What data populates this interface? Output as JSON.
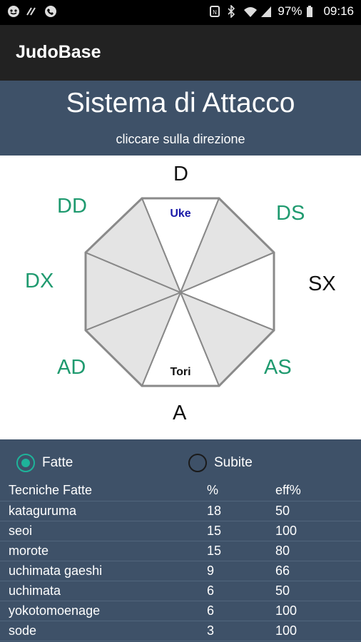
{
  "statusbar": {
    "battery": "97%",
    "time": "09:16"
  },
  "appbar": {
    "title": "JudoBase"
  },
  "header": {
    "title": "Sistema di Attacco",
    "subtitle": "cliccare sulla direzione"
  },
  "diagram": {
    "directions": {
      "d": "D",
      "ds": "DS",
      "sx": "SX",
      "as": "AS",
      "a": "A",
      "ad": "AD",
      "dx": "DX",
      "dd": "DD"
    },
    "top_label": "Uke",
    "bottom_label": "Tori",
    "colors": {
      "green": "#1f9a6f",
      "uke": "#1a1aa8",
      "segment_fill": "#e4e4e4",
      "outline": "#888888"
    }
  },
  "options": {
    "fatte": "Fatte",
    "subite": "Subite",
    "selected": "Fatte",
    "accent": "#1eb39a"
  },
  "table": {
    "headers": [
      "Tecniche Fatte",
      "%",
      "eff%"
    ],
    "rows": [
      [
        "kataguruma",
        "18",
        "50"
      ],
      [
        "seoi",
        "15",
        "100"
      ],
      [
        "morote",
        "15",
        "80"
      ],
      [
        "uchimata gaeshi",
        "9",
        "66"
      ],
      [
        "uchimata",
        "6",
        "50"
      ],
      [
        "yokotomoenage",
        "6",
        "100"
      ],
      [
        "sode",
        "3",
        "100"
      ]
    ]
  }
}
